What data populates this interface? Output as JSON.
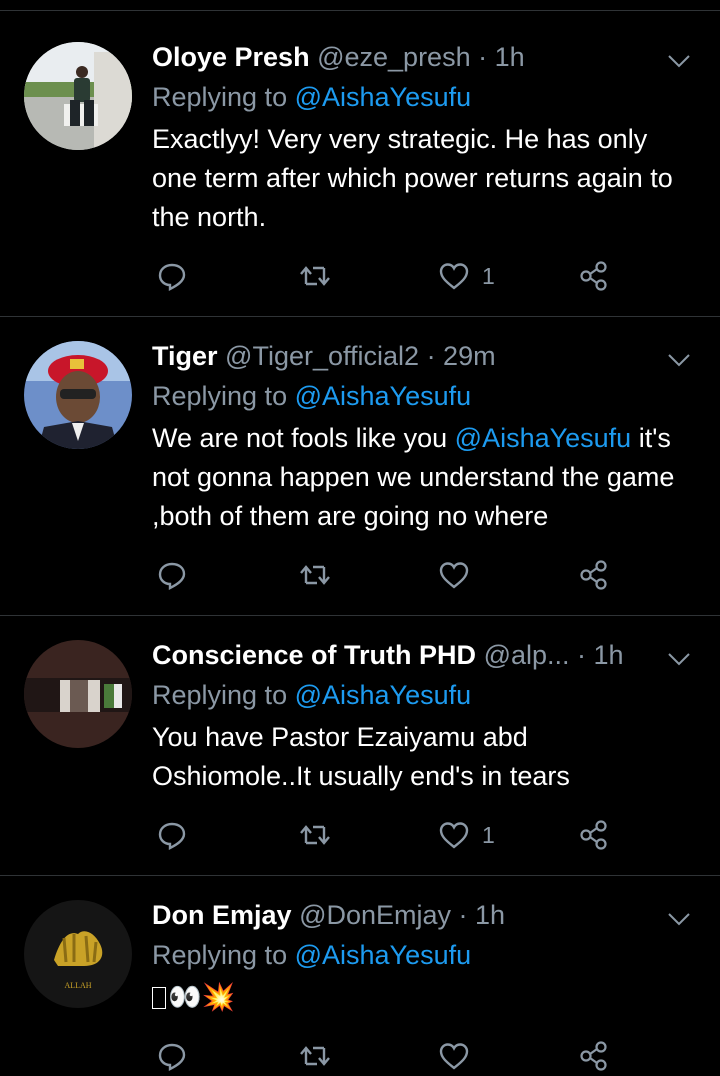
{
  "tweets": [
    {
      "name": "Oloye Presh",
      "handle": "@eze_presh",
      "time": "· 1h",
      "replying_prefix": "Replying to",
      "replying_to": "@AishaYesufu",
      "text": "Exactlyy! Very very strategic. He has only one term after which  power returns again to the north.",
      "likes": "1"
    },
    {
      "name": "Tiger",
      "handle": "@Tiger_official2",
      "time": "· 29m",
      "replying_prefix": "Replying to",
      "replying_to": "@AishaYesufu",
      "text_pre": "We are not fools like you ",
      "text_mention": "@AishaYesufu",
      "text_post": " it's not gonna happen we understand the game ,both of them are going no where",
      "likes": ""
    },
    {
      "name": "Conscience of Truth PHD",
      "handle": "@alp...",
      "time": "· 1h",
      "replying_prefix": "Replying to",
      "replying_to": "@AishaYesufu",
      "text": "You have Pastor Ezaiyamu abd Oshiomole..It usually end's in tears",
      "likes": "1"
    },
    {
      "name": "Don Emjay",
      "handle": "@DonEmjay",
      "time": "· 1h",
      "replying_prefix": "Replying to",
      "replying_to": "@AishaYesufu",
      "text": "👀💥",
      "likes": "",
      "avatar_text": "ALLAH"
    }
  ],
  "icons": [
    "reply-icon",
    "retweet-icon",
    "like-icon",
    "share-icon",
    "chevron-down-icon"
  ],
  "colors": {
    "background": "#000000",
    "link": "#1d9bf0",
    "muted": "#8b98a5",
    "divider": "#2f3336"
  }
}
